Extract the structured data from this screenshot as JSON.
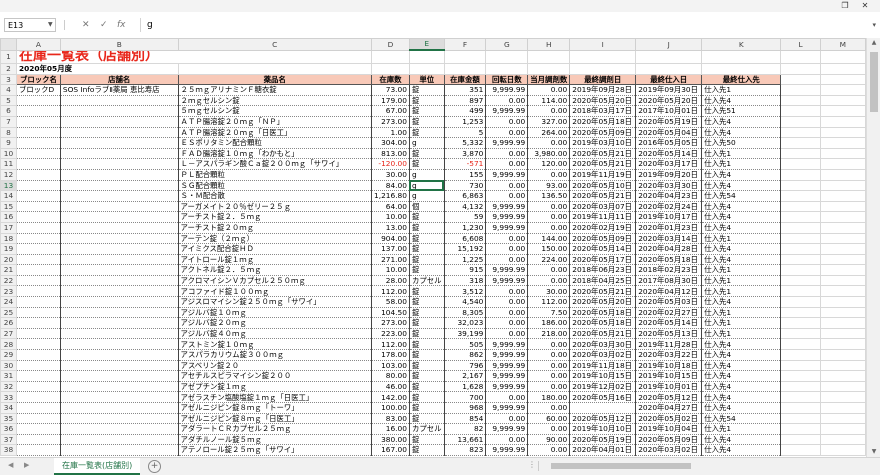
{
  "window": {
    "restore_icon": "❐",
    "close_icon": "✕"
  },
  "formula_bar": {
    "name_box": "E13",
    "formula": "g",
    "cancel": "✕",
    "enter": "✓",
    "fx": "fx"
  },
  "columns": [
    "A",
    "B",
    "C",
    "D",
    "E",
    "F",
    "G",
    "H",
    "I",
    "J",
    "K",
    "L",
    "M"
  ],
  "selected_column": "E",
  "sheet": {
    "title": "在庫一覧表（店舗別）",
    "subtitle": "2020年05月度",
    "headers": [
      "ブロック名",
      "店舗名",
      "薬品名",
      "在庫数",
      "単位",
      "在庫金額",
      "回転日数",
      "当月調剤数",
      "最終調剤日",
      "最終仕入日",
      "最終仕入先"
    ],
    "block": "ブロックD",
    "store": "SOS InfoラブⅡ薬局 恵比寿店",
    "rows": [
      [
        "２５ｍｇアリナミンＦ糖衣錠",
        "73.00",
        "錠",
        "351",
        "9,999.99",
        "0.00",
        "2019年09月28日",
        "2019年09月30日",
        "仕入先1"
      ],
      [
        "２ｍｇセルシン錠",
        "179.00",
        "錠",
        "897",
        "0.00",
        "114.00",
        "2020年05月20日",
        "2020年05月20日",
        "仕入先4"
      ],
      [
        "５ｍｇセルシン錠",
        "67.00",
        "錠",
        "499",
        "9,999.99",
        "0.00",
        "2018年03月17日",
        "2017年10月01日",
        "仕入先51"
      ],
      [
        "ＡＴＰ腸溶錠２０ｍｇ「ＮＰ」",
        "273.00",
        "錠",
        "1,253",
        "0.00",
        "327.00",
        "2020年05月18日",
        "2020年05月19日",
        "仕入先4"
      ],
      [
        "ＡＴＰ腸溶錠２０ｍｇ「日医工」",
        "1.00",
        "錠",
        "5",
        "0.00",
        "264.00",
        "2020年05月09日",
        "2020年05月04日",
        "仕入先4"
      ],
      [
        "ＥＳポリタミン配合顆粒",
        "304.00",
        "g",
        "5,332",
        "9,999.99",
        "0.00",
        "2019年03月10日",
        "2016年05月05日",
        "仕入先50"
      ],
      [
        "ＦＡＤ腸溶錠１０ｍｇ「わかもと」",
        "813.00",
        "錠",
        "3,870",
        "0.00",
        "3,980.00",
        "2020年05月21日",
        "2020年05月14日",
        "仕入先1"
      ],
      [
        "Ｌ－アスパラギン酸Ｃａ錠２００ｍｇ「サワイ」",
        "-120.00",
        "錠",
        "-571",
        "0.00",
        "120.00",
        "2020年05月21日",
        "2020年03月17日",
        "仕入先1"
      ],
      [
        "ＰＬ配合顆粒",
        "30.00",
        "g",
        "155",
        "9,999.99",
        "0.00",
        "2019年11月19日",
        "2019年09月20日",
        "仕入先4"
      ],
      [
        "ＳＧ配合顆粒",
        "84.00",
        "g",
        "730",
        "0.00",
        "93.00",
        "2020年05月10日",
        "2020年03月30日",
        "仕入先4"
      ],
      [
        "Ｓ・Ｍ配合散",
        "1,216.80",
        "g",
        "6,863",
        "0.00",
        "136.50",
        "2020年05月21日",
        "2020年04月23日",
        "仕入先54"
      ],
      [
        "アーガメイト２０％ゼリー２５ｇ",
        "64.00",
        "個",
        "4,132",
        "9,999.99",
        "0.00",
        "2020年03月07日",
        "2020年02月24日",
        "仕入先4"
      ],
      [
        "アーチスト錠２．５ｍｇ",
        "10.00",
        "錠",
        "59",
        "9,999.99",
        "0.00",
        "2019年11月11日",
        "2019年10月17日",
        "仕入先4"
      ],
      [
        "アーチスト錠２０ｍｇ",
        "13.00",
        "錠",
        "1,230",
        "9,999.99",
        "0.00",
        "2020年02月19日",
        "2020年01月23日",
        "仕入先4"
      ],
      [
        "アーテン錠（２ｍｇ）",
        "904.00",
        "錠",
        "6,608",
        "0.00",
        "144.00",
        "2020年05月09日",
        "2020年03月14日",
        "仕入先1"
      ],
      [
        "アイミクス配合錠ＨＤ",
        "137.00",
        "錠",
        "15,192",
        "0.00",
        "150.00",
        "2020年05月14日",
        "2020年04月28日",
        "仕入先4"
      ],
      [
        "アイトロール錠１ｍｇ",
        "271.00",
        "錠",
        "1,225",
        "0.00",
        "224.00",
        "2020年05月17日",
        "2020年05月18日",
        "仕入先4"
      ],
      [
        "アクトネル錠２．５ｍｇ",
        "10.00",
        "錠",
        "915",
        "9,999.99",
        "0.00",
        "2018年06月23日",
        "2018年02月23日",
        "仕入先1"
      ],
      [
        "アクロマイシンＶカプセル２５０ｍｇ",
        "28.00",
        "カプセル",
        "318",
        "9,999.99",
        "0.00",
        "2018年04月25日",
        "2017年08月30日",
        "仕入先1"
      ],
      [
        "アコファイド錠１００ｍｇ",
        "112.00",
        "錠",
        "3,512",
        "0.00",
        "30.00",
        "2020年05月21日",
        "2020年04月12日",
        "仕入先1"
      ],
      [
        "アジスロマイシン錠２５０ｍｇ「サワイ」",
        "58.00",
        "錠",
        "4,540",
        "0.00",
        "112.00",
        "2020年05月20日",
        "2020年05月03日",
        "仕入先4"
      ],
      [
        "アジルバ錠１０ｍｇ",
        "104.50",
        "錠",
        "8,305",
        "0.00",
        "7.50",
        "2020年05月18日",
        "2020年02月27日",
        "仕入先1"
      ],
      [
        "アジルバ錠２０ｍｇ",
        "273.00",
        "錠",
        "32,023",
        "0.00",
        "186.00",
        "2020年05月18日",
        "2020年05月14日",
        "仕入先1"
      ],
      [
        "アジルバ錠４０ｍｇ",
        "223.00",
        "錠",
        "39,199",
        "0.00",
        "218.00",
        "2020年05月21日",
        "2020年05月13日",
        "仕入先1"
      ],
      [
        "アストミン錠１０ｍｇ",
        "112.00",
        "錠",
        "505",
        "9,999.99",
        "0.00",
        "2020年03月30日",
        "2019年11月28日",
        "仕入先4"
      ],
      [
        "アスパラカリウム錠３００ｍｇ",
        "178.00",
        "錠",
        "862",
        "9,999.99",
        "0.00",
        "2020年03月02日",
        "2020年03月22日",
        "仕入先4"
      ],
      [
        "アスベリン錠２０",
        "103.00",
        "錠",
        "796",
        "9,999.99",
        "0.00",
        "2019年11月18日",
        "2019年10月18日",
        "仕入先4"
      ],
      [
        "アセチルスピラマイシン錠２００",
        "80.00",
        "錠",
        "2,167",
        "9,999.99",
        "0.00",
        "2019年10月15日",
        "2019年10月15日",
        "仕入先4"
      ],
      [
        "アゼプチン錠１ｍｇ",
        "46.00",
        "錠",
        "1,628",
        "9,999.99",
        "0.00",
        "2019年12月02日",
        "2019年10月01日",
        "仕入先4"
      ],
      [
        "アゼラスチン塩酸塩錠１ｍｇ「日医工」",
        "142.00",
        "錠",
        "700",
        "0.00",
        "180.00",
        "2020年05月16日",
        "2020年05月12日",
        "仕入先4"
      ],
      [
        "アゼルニジピン錠８ｍｇ「トーワ」",
        "100.00",
        "錠",
        "968",
        "9,999.99",
        "0.00",
        "",
        "2020年04月27日",
        "仕入先4"
      ],
      [
        "アゼルニジピン錠８ｍｇ「日医工」",
        "83.00",
        "錠",
        "854",
        "0.00",
        "60.00",
        "2020年05月12日",
        "2020年05月02日",
        "仕入先54"
      ],
      [
        "アダラートＣＲカプセル２５ｍｇ",
        "16.00",
        "カプセル",
        "82",
        "9,999.99",
        "0.00",
        "2019年10月10日",
        "2019年10月04日",
        "仕入先1"
      ],
      [
        "アダチルノール錠５ｍｇ",
        "380.00",
        "錠",
        "13,661",
        "0.00",
        "90.00",
        "2020年05月19日",
        "2020年05月09日",
        "仕入先4"
      ],
      [
        "アテノロール錠２５ｍｇ「サワイ」",
        "167.00",
        "錠",
        "823",
        "9,999.99",
        "0.00",
        "2020年04月01日",
        "2020年03月02日",
        "仕入先4"
      ]
    ]
  },
  "tabs": {
    "active": "在庫一覧表(店舗別)",
    "add": "+"
  }
}
